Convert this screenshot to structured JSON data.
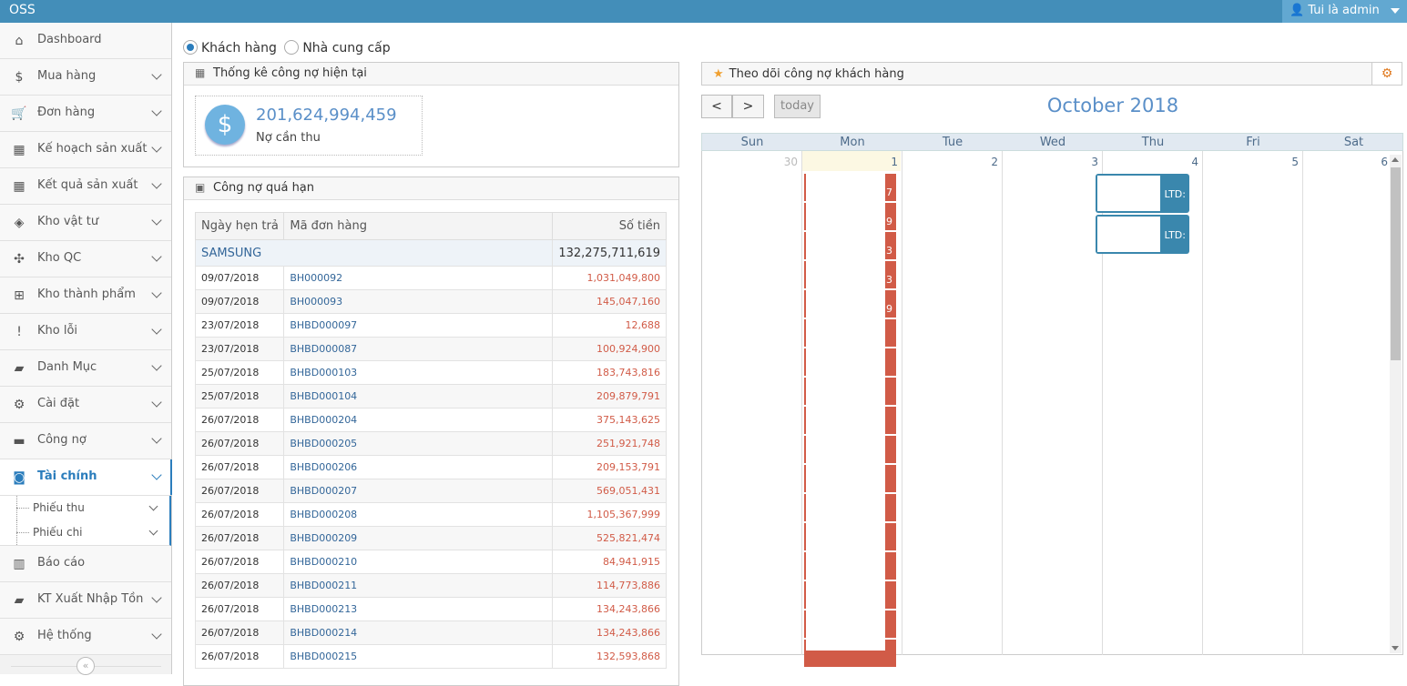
{
  "app": {
    "title": "OSS",
    "user_label": "Tui là admin"
  },
  "sidebar": {
    "items": [
      {
        "label": "Dashboard",
        "icon": "home-icon",
        "glyph": "⌂"
      },
      {
        "label": "Mua hàng",
        "icon": "dollar-icon",
        "glyph": "$"
      },
      {
        "label": "Đơn hàng",
        "icon": "cart-icon",
        "glyph": "🛒"
      },
      {
        "label": "Kế hoạch sản xuất",
        "icon": "calendar-icon",
        "glyph": "▦"
      },
      {
        "label": "Kết quả sản xuất",
        "icon": "calendar-icon",
        "glyph": "▦"
      },
      {
        "label": "Kho vật tư",
        "icon": "cube-icon",
        "glyph": "◈"
      },
      {
        "label": "Kho QC",
        "icon": "joomla-icon",
        "glyph": "✣"
      },
      {
        "label": "Kho thành phẩm",
        "icon": "windows-icon",
        "glyph": "⊞"
      },
      {
        "label": "Kho lỗi",
        "icon": "exclamation-icon",
        "glyph": "!"
      },
      {
        "label": "Danh Mục",
        "icon": "folder-icon",
        "glyph": "▰"
      },
      {
        "label": "Cài đặt",
        "icon": "gears-icon",
        "glyph": "⚙"
      },
      {
        "label": "Công nợ",
        "icon": "book-icon",
        "glyph": "▬"
      },
      {
        "label": "Tài chính",
        "icon": "money-icon",
        "glyph": "◙"
      }
    ],
    "sub_items": [
      {
        "label": "Phiếu thu"
      },
      {
        "label": "Phiếu chi"
      }
    ],
    "bottom_items": [
      {
        "label": "Báo cáo",
        "icon": "bar-chart-icon",
        "glyph": "▥"
      },
      {
        "label": "KT Xuất Nhập Tồn",
        "icon": "folder-icon",
        "glyph": "▰"
      },
      {
        "label": "Hệ thống",
        "icon": "gear-icon",
        "glyph": "⚙"
      }
    ],
    "collapse_glyph": "«"
  },
  "filter": {
    "options": [
      "Khách hàng",
      "Nhà cung cấp"
    ],
    "selected": "Khách hàng"
  },
  "stats_panel": {
    "title": "Thống kê công nợ hiện tại",
    "value": "201,624,994,459",
    "label": "Nợ cần thu",
    "glyph": "$"
  },
  "overdue_panel": {
    "title": "Công nợ quá hạn",
    "columns": [
      "Ngày hẹn trả",
      "Mã đơn hàng",
      "Số tiền"
    ],
    "group": {
      "name": "SAMSUNG",
      "total": "132,275,711,619"
    },
    "rows": [
      [
        "09/07/2018",
        "BH000092",
        "1,031,049,800"
      ],
      [
        "09/07/2018",
        "BH000093",
        "145,047,160"
      ],
      [
        "23/07/2018",
        "BHBD000097",
        "12,688"
      ],
      [
        "23/07/2018",
        "BHBD000087",
        "100,924,900"
      ],
      [
        "25/07/2018",
        "BHBD000103",
        "183,743,816"
      ],
      [
        "25/07/2018",
        "BHBD000104",
        "209,879,791"
      ],
      [
        "26/07/2018",
        "BHBD000204",
        "375,143,625"
      ],
      [
        "26/07/2018",
        "BHBD000205",
        "251,921,748"
      ],
      [
        "26/07/2018",
        "BHBD000206",
        "209,153,791"
      ],
      [
        "26/07/2018",
        "BHBD000207",
        "569,051,431"
      ],
      [
        "26/07/2018",
        "BHBD000208",
        "1,105,367,999"
      ],
      [
        "26/07/2018",
        "BHBD000209",
        "525,821,474"
      ],
      [
        "26/07/2018",
        "BHBD000210",
        "84,941,915"
      ],
      [
        "26/07/2018",
        "BHBD000211",
        "114,773,886"
      ],
      [
        "26/07/2018",
        "BHBD000213",
        "134,243,866"
      ],
      [
        "26/07/2018",
        "BHBD000214",
        "134,243,866"
      ],
      [
        "26/07/2018",
        "BHBD000215",
        "132,593,868"
      ]
    ]
  },
  "calendar": {
    "panel_title": "Theo dõi công nợ khách hàng",
    "month_title": "October 2018",
    "today_label": "today",
    "prev_glyph": "<",
    "next_glyph": ">",
    "weekdays": [
      "Sun",
      "Mon",
      "Tue",
      "Wed",
      "Thu",
      "Fri",
      "Sat"
    ],
    "days": [
      "30",
      "1",
      "2",
      "3",
      "4",
      "5",
      "6"
    ],
    "mon_event_digits": [
      "7",
      "9",
      "3",
      "3",
      "9"
    ],
    "thu_events": [
      {
        "text": ", LTD:"
      },
      {
        "text": ", LTD:"
      }
    ],
    "colors": {
      "event_red": "#d15b47",
      "event_blue": "#3a87ad",
      "today_bg": "#fcf8e3"
    }
  },
  "colors": {
    "topbar": "#438eb9",
    "accent": "#2b7dbc",
    "amount": "#d15b47"
  }
}
